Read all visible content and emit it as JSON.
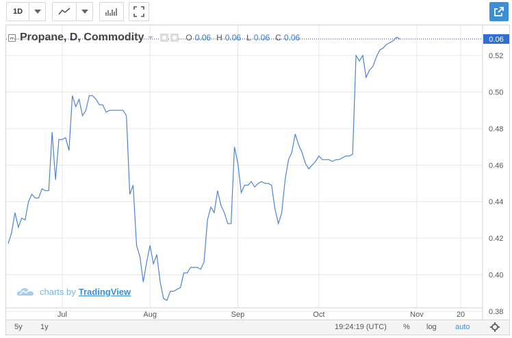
{
  "toolbar": {
    "interval": "1D",
    "colors": {
      "share_bg": "#3b8fd9"
    }
  },
  "legend": {
    "symbol": "Propane, D, Commodity",
    "o_label": "O",
    "o_value": "0.06",
    "h_label": "H",
    "h_value": "0.06",
    "l_label": "L",
    "l_value": "0.06",
    "c_label": "C",
    "c_value": "0.06"
  },
  "watermark": {
    "prefix": "charts by",
    "brand": "TradingView"
  },
  "bottombar": {
    "range_5y": "5y",
    "range_1y": "1y",
    "time": "19:24:19 (UTC)",
    "percent": "%",
    "log": "log",
    "auto": "auto"
  },
  "chart_data": {
    "type": "line",
    "line_color": "#4a84d6",
    "price_badge": "0.06",
    "y_ticks": [
      "0.52",
      "0.50",
      "0.48",
      "0.46",
      "0.44",
      "0.42",
      "0.40",
      "0.38"
    ],
    "y_tick_values": [
      0.52,
      0.5,
      0.48,
      0.46,
      0.44,
      0.42,
      0.4,
      0.38
    ],
    "x_ticks": [
      "Jul",
      "Aug",
      "Sep",
      "Oct",
      "Nov",
      "20"
    ],
    "x_tick_index": [
      16,
      42,
      68,
      92,
      121,
      134
    ],
    "ylim": [
      0.3755,
      0.5365
    ],
    "x_count": 136,
    "grid": true,
    "values": [
      0.417,
      0.423,
      0.434,
      0.426,
      0.431,
      0.43,
      0.44,
      0.444,
      0.442,
      0.442,
      0.447,
      0.446,
      0.446,
      0.478,
      0.452,
      0.474,
      0.474,
      0.475,
      0.468,
      0.498,
      0.492,
      0.496,
      0.487,
      0.49,
      0.498,
      0.498,
      0.496,
      0.493,
      0.493,
      0.489,
      0.49,
      0.49,
      0.49,
      0.49,
      0.49,
      0.487,
      0.444,
      0.449,
      0.416,
      0.41,
      0.396,
      0.407,
      0.416,
      0.406,
      0.411,
      0.396,
      0.387,
      0.386,
      0.391,
      0.391,
      0.392,
      0.393,
      0.401,
      0.401,
      0.404,
      0.404,
      0.404,
      0.403,
      0.407,
      0.43,
      0.437,
      0.434,
      0.446,
      0.438,
      0.434,
      0.428,
      0.428,
      0.47,
      0.461,
      0.445,
      0.449,
      0.449,
      0.451,
      0.448,
      0.45,
      0.451,
      0.45,
      0.45,
      0.449,
      0.436,
      0.428,
      0.434,
      0.452,
      0.463,
      0.467,
      0.477,
      0.471,
      0.467,
      0.461,
      0.458,
      0.46,
      0.462,
      0.465,
      0.463,
      0.463,
      0.463,
      0.462,
      0.463,
      0.463,
      0.464,
      0.465,
      0.465,
      0.466,
      0.52,
      0.517,
      0.52,
      0.508,
      0.512,
      0.514,
      0.519,
      0.523,
      0.524,
      0.526,
      0.527,
      0.528,
      0.53,
      0.529
    ]
  }
}
